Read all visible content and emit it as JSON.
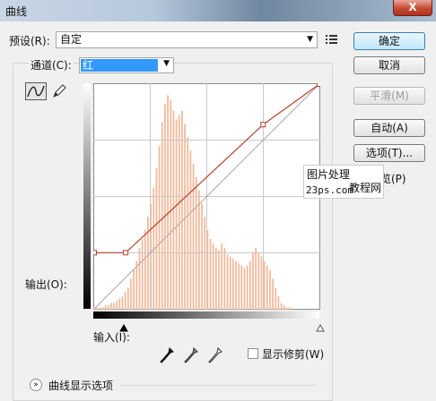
{
  "window": {
    "title": "曲线",
    "close_glyph": "X"
  },
  "preset": {
    "label": "预设(R):",
    "value": "自定",
    "menu_icon": "preset-options-icon"
  },
  "channel": {
    "label": "通道(C):",
    "value": "红"
  },
  "buttons": {
    "ok": "确定",
    "cancel": "取消",
    "smooth": "平滑(M)",
    "auto": "自动(A)",
    "options": "选项(T)..."
  },
  "preview": {
    "label": "预览(P)",
    "checked": false
  },
  "output_label": "输出(O):",
  "input_label": "输入(I):",
  "show_clipping": {
    "label": "显示修剪(W)",
    "checked": false
  },
  "curve_display_options": "曲线显示选项",
  "watermark": {
    "line1": "图片处理",
    "line2": "23ps.com",
    "line3": "教程网"
  },
  "curve": {
    "color": "#b4412c",
    "points": [
      [
        0,
        0.25
      ],
      [
        0.14,
        0.25
      ],
      [
        0.75,
        0.82
      ],
      [
        1,
        1
      ]
    ]
  },
  "histogram": {
    "color": "#f2b898",
    "bins": [
      0.01,
      0.01,
      0.01,
      0.01,
      0.02,
      0.02,
      0.03,
      0.03,
      0.04,
      0.05,
      0.06,
      0.08,
      0.1,
      0.14,
      0.18,
      0.22,
      0.28,
      0.32,
      0.36,
      0.42,
      0.48,
      0.55,
      0.64,
      0.74,
      0.85,
      0.93,
      0.97,
      0.95,
      0.9,
      0.86,
      0.88,
      0.9,
      0.84,
      0.78,
      0.72,
      0.66,
      0.6,
      0.54,
      0.48,
      0.42,
      0.36,
      0.32,
      0.3,
      0.28,
      0.27,
      0.3,
      0.28,
      0.25,
      0.24,
      0.23,
      0.22,
      0.21,
      0.2,
      0.19,
      0.2,
      0.22,
      0.26,
      0.28,
      0.26,
      0.24,
      0.22,
      0.2,
      0.18,
      0.14,
      0.1,
      0.06,
      0.03,
      0.02,
      0.01,
      0.01,
      0.0,
      0.0,
      0.0,
      0.0,
      0.0,
      0.0,
      0.0,
      0.0,
      0.0,
      0.0
    ]
  },
  "icons": {
    "curve_tool": "curve-tool-icon",
    "pencil_tool": "pencil-tool-icon",
    "black_point": "eyedropper-black-icon",
    "gray_point": "eyedropper-gray-icon",
    "white_point": "eyedropper-white-icon"
  }
}
